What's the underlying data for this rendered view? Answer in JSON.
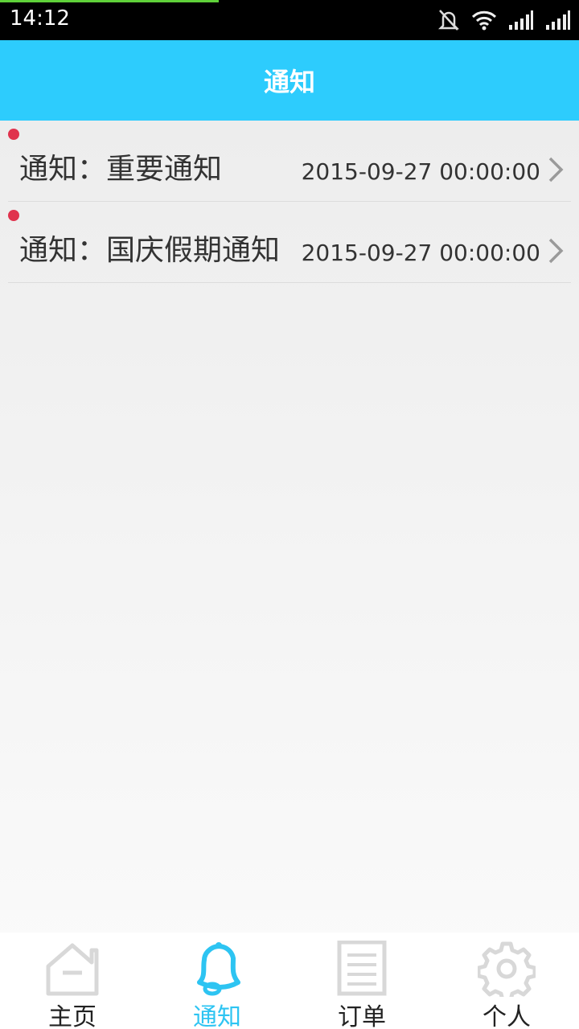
{
  "status_bar": {
    "time": "14:12",
    "icons": [
      "mute-icon",
      "wifi-icon",
      "signal-icon",
      "signal-icon"
    ]
  },
  "header": {
    "title": "通知"
  },
  "notifications": [
    {
      "title": "通知：重要通知",
      "time": "2015-09-27 00:00:00",
      "unread": true
    },
    {
      "title": "通知：国庆假期通知",
      "time": "2015-09-27 00:00:00",
      "unread": true
    }
  ],
  "tabbar": {
    "items": [
      {
        "label": "主页",
        "icon": "home-icon",
        "active": false
      },
      {
        "label": "通知",
        "icon": "bell-icon",
        "active": true
      },
      {
        "label": "订单",
        "icon": "document-icon",
        "active": false
      },
      {
        "label": "个人",
        "icon": "gear-icon",
        "active": false
      }
    ]
  },
  "colors": {
    "accent": "#2dccfd",
    "unread_dot": "#e0334d",
    "active_tab": "#2dc4f2"
  }
}
